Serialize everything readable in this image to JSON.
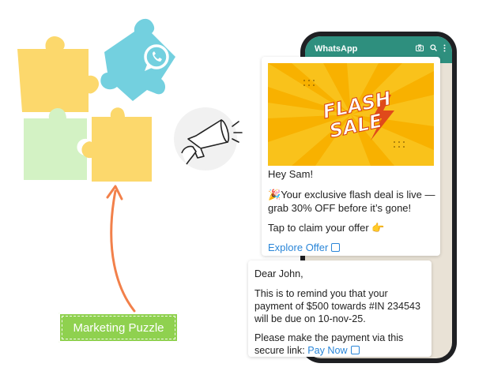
{
  "app": {
    "title": "WhatsApp"
  },
  "icons": {
    "camera": "camera-icon",
    "search": "search-icon",
    "menu": "more-vertical-icon",
    "whatsapp": "whatsapp-logo-icon"
  },
  "colors": {
    "whatsapp_bar": "#2e8f7e",
    "label_green": "#8fd14f",
    "link": "#2a86d8",
    "arrow": "#f2804a"
  },
  "diagram": {
    "label": "Marketing Puzzle"
  },
  "message1": {
    "banner_top": "FLASH",
    "banner_bottom": "SALE",
    "greeting": "Hey Sam!",
    "body_emoji": "🎉",
    "body": "Your exclusive flash deal is live — grab 30% OFF before it’s gone!",
    "cta_text": "Tap to claim your offer",
    "cta_emoji": "👉",
    "link_label": "Explore Offer"
  },
  "message2": {
    "greeting": "Dear John,",
    "body": "This is to remind you that your payment of $500 towards #IN 234543 will be due on 10-nov-25.",
    "prompt": "Please make the payment via this secure link:",
    "link_label": "Pay Now"
  }
}
